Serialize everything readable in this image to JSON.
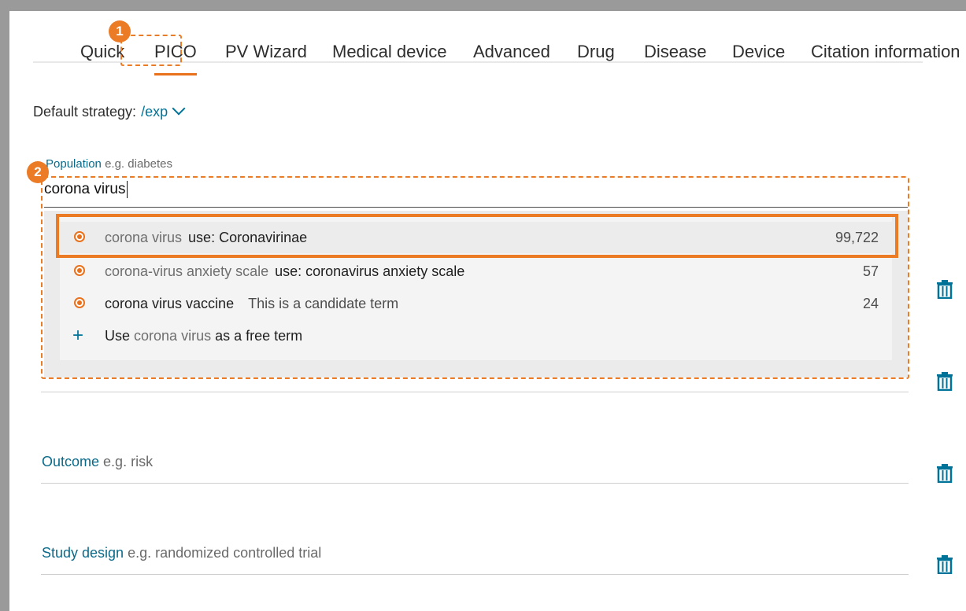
{
  "tabs": [
    "Quick",
    "PICO",
    "PV Wizard",
    "Medical device",
    "Advanced",
    "Drug",
    "Disease",
    "Device",
    "Citation information"
  ],
  "active_tab": "PICO",
  "badges": [
    "1",
    "2"
  ],
  "strategy": {
    "label": "Default strategy:",
    "value": "/exp"
  },
  "population": {
    "label": "Population",
    "hint": "e.g. diabetes",
    "value": "corona virus"
  },
  "suggestions": [
    {
      "term": "corona virus",
      "use": "use: Coronavirinae",
      "count": "99,722"
    },
    {
      "term": "corona-virus anxiety scale",
      "use": "use: coronavirus anxiety scale",
      "count": "57"
    },
    {
      "term": "corona virus vaccine",
      "candidate": "This is a candidate term",
      "count": "24"
    }
  ],
  "free_term": {
    "prefix": "Use",
    "term": "corona virus",
    "suffix": "as a free term"
  },
  "outcome": {
    "label": "Outcome",
    "hint": "e.g. risk"
  },
  "study_design": {
    "label": "Study design",
    "hint": "e.g. randomized controlled trial"
  },
  "colors": {
    "accent": "#ec7b26",
    "link": "#007398"
  }
}
